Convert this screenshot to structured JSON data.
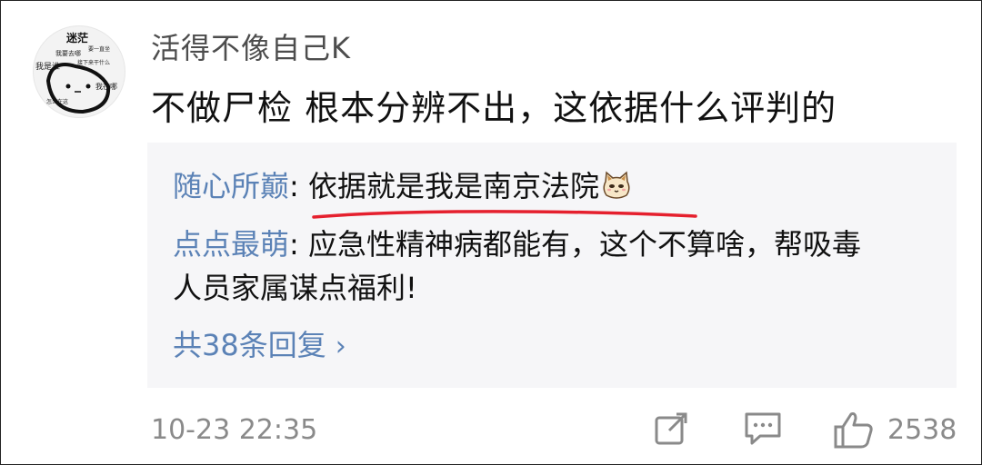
{
  "comment": {
    "avatar_texts": [
      "迷茫",
      "我要去哪",
      "要一直坐",
      "接下来干什么",
      "我是谁",
      "我在哪",
      "怎么在这"
    ],
    "username": "活得不像自己K",
    "text": "不做尸检 根本分辨不出，这依据什么评判的"
  },
  "replies": [
    {
      "user": "随心所巅",
      "separator": ": ",
      "text": "依据就是我是南京法院",
      "emoji": "cat-face-icon"
    },
    {
      "user": "点点最萌",
      "separator": ": ",
      "text": "应急性精神病都能有，这个不算啥，帮吸毒人员家属谋点福利!"
    }
  ],
  "more_replies_label": "共38条回复",
  "footer": {
    "time": "10-23 22:35",
    "like_count": "2538"
  },
  "colors": {
    "link_blue": "#5b82b6",
    "underline_red": "#e5202e",
    "muted_gray": "#8a8a8a"
  }
}
